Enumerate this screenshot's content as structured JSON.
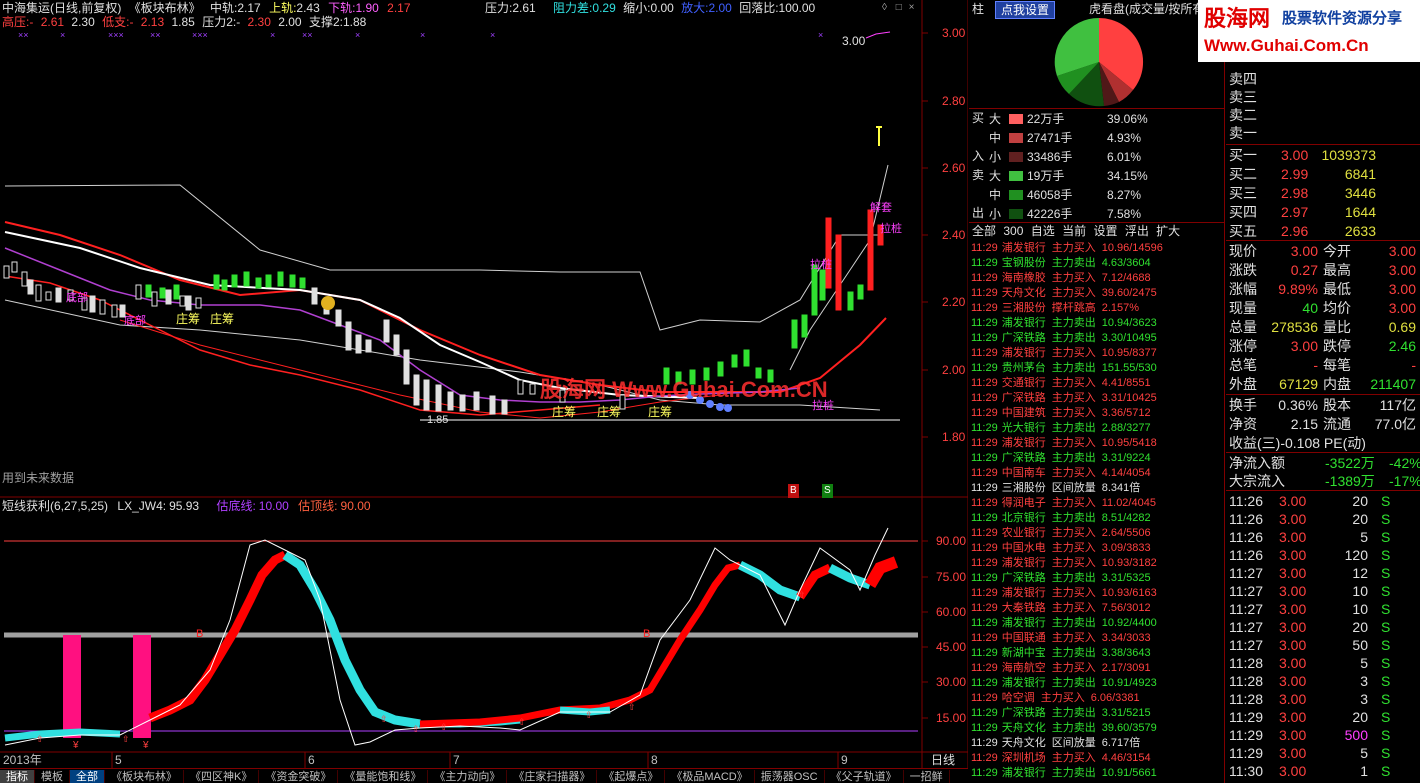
{
  "header": {
    "title": "中海集运(日线,前复权)",
    "board": "《板块布林》",
    "mid_label": "中轨:",
    "mid": "2.17",
    "upper_label": "上轨:",
    "upper": "2.43",
    "lower_label": "下轨:",
    "lower": "1.90",
    "lower2": "2.17",
    "pressure_label": "压力:",
    "pressure": "2.61",
    "resist_label": "阻力差:",
    "resist": "0.29",
    "shrink_label": "缩小:",
    "shrink": "0.00",
    "enlarge_label": "放大:",
    "enlarge": "2.00",
    "drawdown_label": "回落比:",
    "drawdown": "100.00"
  },
  "header2": {
    "hp_label": "高压:",
    "hp1": "-",
    "hp2": "2.61",
    "hp3": "2.30",
    "lowsup_label": "低支:",
    "ls1": "-",
    "ls2": "2.13",
    "ls3": "1.85",
    "p2_label": "压力2:",
    "p2a": "-",
    "p2b": "2.30",
    "p2c": "2.00",
    "s2_label": "支撑2:",
    "s2": "1.88"
  },
  "main_chart": {
    "yaxis": [
      "3.00",
      "2.80",
      "2.60",
      "2.40",
      "2.20",
      "2.00",
      "1.80"
    ],
    "annotations": {
      "lowest": "1.85",
      "high_label": "3.00",
      "bottom1": "底部",
      "bottom2": "底部",
      "z1": "庄筹",
      "z2": "庄筹",
      "z3": "庄筹",
      "z4": "庄筹",
      "z5": "庄筹",
      "tips1": "解套",
      "tips2": "拉桩",
      "tips3": "拉桩",
      "tips4": "拉桩",
      "future": "用到未来数据",
      "b": "B",
      "s": "S"
    }
  },
  "watermark": "股海网 Www.Guhai.Com.CN",
  "indicator": {
    "name": "短线获利(6,27,5,25)",
    "lx_label": "LX_JW4:",
    "lx": "95.93",
    "bottom_label": "估底线:",
    "bottom": "10.00",
    "top_label": "估顶线:",
    "top": "90.00",
    "yaxis": [
      "90.00",
      "75.00",
      "60.00",
      "45.00",
      "30.00",
      "15.00"
    ],
    "mark_b": "B",
    "mark_yen": "¥"
  },
  "xaxis": {
    "labels": [
      "2013年",
      "5",
      "6",
      "7",
      "8",
      "9"
    ],
    "period": "日线"
  },
  "bottom_tabs": [
    "指标",
    "模板",
    "全部",
    "《板块布林》",
    "《四区神K》",
    "《资金突破》",
    "《量能饱和线》",
    "《主力动向》",
    "《庄家扫描器》",
    "《起爆点》",
    "《极品MACD》",
    "振荡器OSC",
    "《父子轨道》",
    "一招鲜"
  ],
  "right_panel": {
    "top_left": "柱",
    "click_setting": "点我设置",
    "pie_title": "虎看盘(成交量/按所有)",
    "logo1": "股海网",
    "logo2": "股票软件资源分享",
    "logo3": "Www.Guhai.Com.Cn",
    "buy_label": "买",
    "in_label": "入",
    "sell_label": "卖",
    "out_label": "出",
    "flow": [
      {
        "size": "大",
        "vol": "22万手",
        "pct": "39.06%",
        "color": "#ff6060"
      },
      {
        "size": "中",
        "vol": "27471手",
        "pct": "4.93%",
        "color": "#c04040"
      },
      {
        "size": "小",
        "vol": "33486手",
        "pct": "6.01%",
        "color": "#602020"
      },
      {
        "size": "大",
        "vol": "19万手",
        "pct": "34.15%",
        "color": "#40c040"
      },
      {
        "size": "中",
        "vol": "46058手",
        "pct": "8.27%",
        "color": "#209020"
      },
      {
        "size": "小",
        "vol": "42226手",
        "pct": "7.58%",
        "color": "#105010"
      }
    ],
    "filter_tabs": [
      "全部",
      "300",
      "自选",
      "当前",
      "设置",
      "浮出",
      "扩大"
    ],
    "ticker": [
      [
        "11:29",
        "浦发银行",
        "主力买入",
        "10.96/14596",
        "r"
      ],
      [
        "11:29",
        "宝钢股份",
        "主力卖出",
        "4.63/3604",
        "g"
      ],
      [
        "11:29",
        "海南橡胶",
        "主力买入",
        "7.12/4688",
        "r"
      ],
      [
        "11:29",
        "天舟文化",
        "主力买入",
        "39.60/2475",
        "r"
      ],
      [
        "11:29",
        "三湘股份",
        "撑杆跳高",
        "2.157%",
        "r"
      ],
      [
        "11:29",
        "浦发银行",
        "主力卖出",
        "10.94/3623",
        "g"
      ],
      [
        "11:29",
        "广深铁路",
        "主力卖出",
        "3.30/10495",
        "g"
      ],
      [
        "11:29",
        "浦发银行",
        "主力买入",
        "10.95/8377",
        "r"
      ],
      [
        "11:29",
        "贵州茅台",
        "主力卖出",
        "151.55/530",
        "g"
      ],
      [
        "11:29",
        "交通银行",
        "主力买入",
        "4.41/8551",
        "r"
      ],
      [
        "11:29",
        "广深铁路",
        "主力买入",
        "3.31/10425",
        "r"
      ],
      [
        "11:29",
        "中国建筑",
        "主力买入",
        "3.36/5712",
        "r"
      ],
      [
        "11:29",
        "光大银行",
        "主力卖出",
        "2.88/3277",
        "g"
      ],
      [
        "11:29",
        "浦发银行",
        "主力买入",
        "10.95/5418",
        "r"
      ],
      [
        "11:29",
        "广深铁路",
        "主力卖出",
        "3.31/9224",
        "g"
      ],
      [
        "11:29",
        "中国南车",
        "主力买入",
        "4.14/4054",
        "r"
      ],
      [
        "11:29",
        "三湘股份",
        "区间放量",
        "8.341倍",
        "w"
      ],
      [
        "11:29",
        "得润电子",
        "主力买入",
        "11.02/4045",
        "r"
      ],
      [
        "11:29",
        "北京银行",
        "主力卖出",
        "8.51/4282",
        "g"
      ],
      [
        "11:29",
        "农业银行",
        "主力买入",
        "2.64/5506",
        "r"
      ],
      [
        "11:29",
        "中国水电",
        "主力买入",
        "3.09/3833",
        "r"
      ],
      [
        "11:29",
        "浦发银行",
        "主力买入",
        "10.93/3182",
        "r"
      ],
      [
        "11:29",
        "广深铁路",
        "主力卖出",
        "3.31/5325",
        "g"
      ],
      [
        "11:29",
        "浦发银行",
        "主力买入",
        "10.93/6163",
        "r"
      ],
      [
        "11:29",
        "大秦铁路",
        "主力买入",
        "7.56/3012",
        "r"
      ],
      [
        "11:29",
        "浦发银行",
        "主力卖出",
        "10.92/4400",
        "g"
      ],
      [
        "11:29",
        "中国联通",
        "主力买入",
        "3.34/3033",
        "r"
      ],
      [
        "11:29",
        "新湖中宝",
        "主力卖出",
        "3.38/3643",
        "g"
      ],
      [
        "11:29",
        "海南航空",
        "主力买入",
        "2.17/3091",
        "r"
      ],
      [
        "11:29",
        "浦发银行",
        "主力卖出",
        "10.91/4923",
        "g"
      ],
      [
        "11:29",
        "哈空调",
        "主力买入",
        "6.06/3381",
        "r"
      ],
      [
        "11:29",
        "广深铁路",
        "主力卖出",
        "3.31/5215",
        "g"
      ],
      [
        "11:29",
        "天舟文化",
        "主力卖出",
        "39.60/3579",
        "g"
      ],
      [
        "11:29",
        "天舟文化",
        "区间放量",
        "6.717倍",
        "w"
      ],
      [
        "11:29",
        "深圳机场",
        "主力买入",
        "4.46/3154",
        "r"
      ],
      [
        "11:29",
        "浦发银行",
        "主力卖出",
        "10.91/5661",
        "g"
      ]
    ]
  },
  "quote": {
    "asks": [
      {
        "label": "卖四"
      },
      {
        "label": "卖三"
      },
      {
        "label": "卖二"
      },
      {
        "label": "卖一"
      }
    ],
    "bids": [
      {
        "label": "买一",
        "price": "3.00",
        "vol": "1039373"
      },
      {
        "label": "买二",
        "price": "2.99",
        "vol": "6841"
      },
      {
        "label": "买三",
        "price": "2.98",
        "vol": "3446"
      },
      {
        "label": "买四",
        "price": "2.97",
        "vol": "1644"
      },
      {
        "label": "买五",
        "price": "2.96",
        "vol": "2633"
      }
    ],
    "stats": [
      [
        "现价",
        "3.00",
        "今开",
        "3.00"
      ],
      [
        "涨跌",
        "0.27",
        "最高",
        "3.00"
      ],
      [
        "涨幅",
        "9.89%",
        "最低",
        "3.00"
      ],
      [
        "现量",
        "40",
        "均价",
        "3.00"
      ],
      [
        "总量",
        "278536",
        "量比",
        "0.69"
      ],
      [
        "涨停",
        "3.00",
        "跌停",
        "2.46"
      ],
      [
        "总笔",
        "-",
        "每笔",
        "-"
      ],
      [
        "外盘",
        "67129",
        "内盘",
        "211407"
      ]
    ],
    "stats2": [
      [
        "换手",
        "0.36%",
        "股本",
        "117亿"
      ],
      [
        "净资",
        "2.15",
        "流通",
        "77.0亿"
      ]
    ],
    "pe": "收益(三)-0.108 PE(动)",
    "net_in_label": "净流入额",
    "net_in": "-3522万",
    "net_in_pct": "-42%",
    "big_in_label": "大宗流入",
    "big_in": "-1389万",
    "big_in_pct": "-17%",
    "ticks": [
      [
        "11:26",
        "3.00",
        "20",
        "S"
      ],
      [
        "11:26",
        "3.00",
        "20",
        "S"
      ],
      [
        "11:26",
        "3.00",
        "5",
        "S"
      ],
      [
        "11:26",
        "3.00",
        "120",
        "S"
      ],
      [
        "11:27",
        "3.00",
        "12",
        "S"
      ],
      [
        "11:27",
        "3.00",
        "10",
        "S"
      ],
      [
        "11:27",
        "3.00",
        "10",
        "S"
      ],
      [
        "11:27",
        "3.00",
        "20",
        "S"
      ],
      [
        "11:27",
        "3.00",
        "50",
        "S"
      ],
      [
        "11:28",
        "3.00",
        "5",
        "S"
      ],
      [
        "11:28",
        "3.00",
        "3",
        "S"
      ],
      [
        "11:28",
        "3.00",
        "3",
        "S"
      ],
      [
        "11:29",
        "3.00",
        "20",
        "S"
      ],
      [
        "11:29",
        "3.00",
        "500",
        "S"
      ],
      [
        "11:29",
        "3.00",
        "5",
        "S"
      ],
      [
        "11:30",
        "3.00",
        "1",
        "S"
      ]
    ]
  }
}
